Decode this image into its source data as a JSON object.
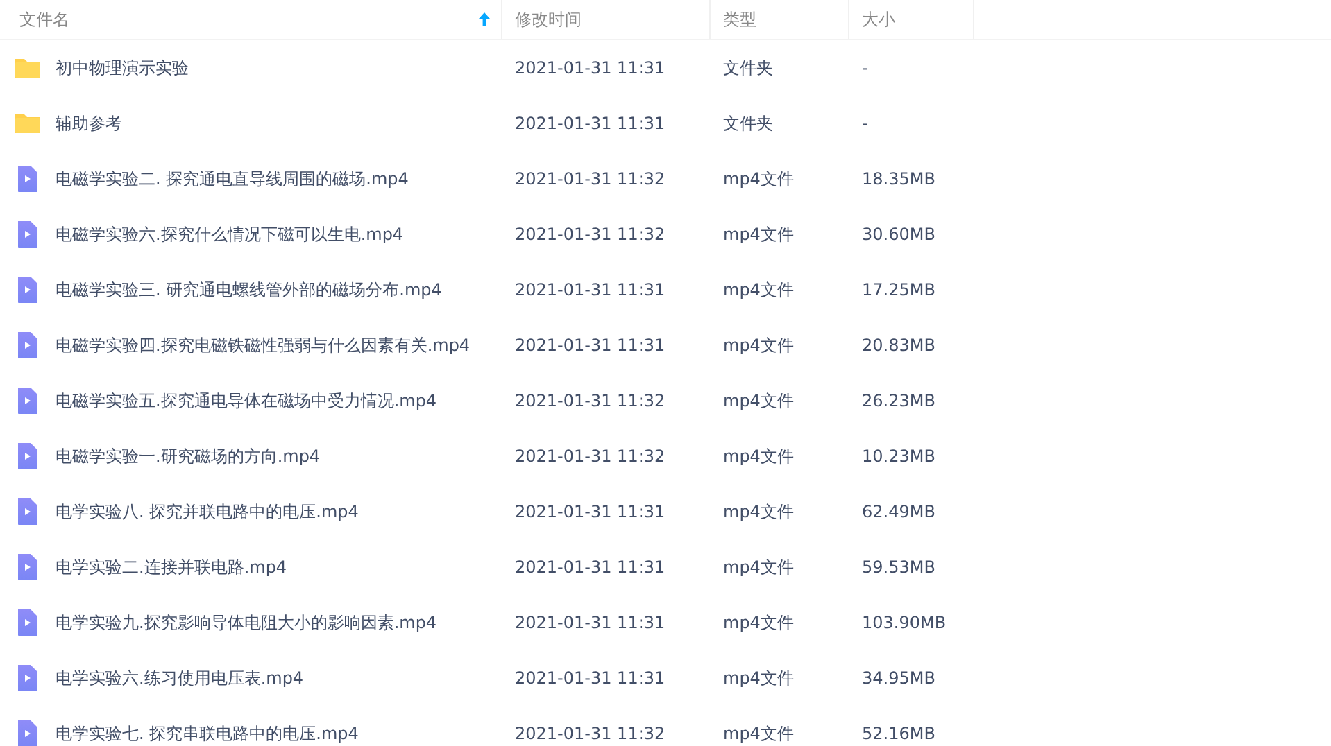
{
  "table": {
    "columns": [
      {
        "label": "文件名",
        "sorted": true
      },
      {
        "label": "修改时间",
        "sorted": false
      },
      {
        "label": "类型",
        "sorted": false
      },
      {
        "label": "大小",
        "sorted": false
      }
    ],
    "rows": [
      {
        "kind": "folder",
        "name": "初中物理演示实验",
        "modified": "2021-01-31 11:31",
        "type": "文件夹",
        "size": "-"
      },
      {
        "kind": "folder",
        "name": "辅助参考",
        "modified": "2021-01-31 11:31",
        "type": "文件夹",
        "size": "-"
      },
      {
        "kind": "video",
        "name": "电磁学实验二. 探究通电直导线周围的磁场.mp4",
        "modified": "2021-01-31 11:32",
        "type": "mp4文件",
        "size": "18.35MB"
      },
      {
        "kind": "video",
        "name": "电磁学实验六.探究什么情况下磁可以生电.mp4",
        "modified": "2021-01-31 11:32",
        "type": "mp4文件",
        "size": "30.60MB"
      },
      {
        "kind": "video",
        "name": "电磁学实验三. 研究通电螺线管外部的磁场分布.mp4",
        "modified": "2021-01-31 11:31",
        "type": "mp4文件",
        "size": "17.25MB"
      },
      {
        "kind": "video",
        "name": "电磁学实验四.探究电磁铁磁性强弱与什么因素有关.mp4",
        "modified": "2021-01-31 11:31",
        "type": "mp4文件",
        "size": "20.83MB"
      },
      {
        "kind": "video",
        "name": "电磁学实验五.探究通电导体在磁场中受力情况.mp4",
        "modified": "2021-01-31 11:32",
        "type": "mp4文件",
        "size": "26.23MB"
      },
      {
        "kind": "video",
        "name": "电磁学实验一.研究磁场的方向.mp4",
        "modified": "2021-01-31 11:32",
        "type": "mp4文件",
        "size": "10.23MB"
      },
      {
        "kind": "video",
        "name": "电学实验八. 探究并联电路中的电压.mp4",
        "modified": "2021-01-31 11:31",
        "type": "mp4文件",
        "size": "62.49MB"
      },
      {
        "kind": "video",
        "name": "电学实验二.连接并联电路.mp4",
        "modified": "2021-01-31 11:31",
        "type": "mp4文件",
        "size": "59.53MB"
      },
      {
        "kind": "video",
        "name": "电学实验九.探究影响导体电阻大小的影响因素.mp4",
        "modified": "2021-01-31 11:31",
        "type": "mp4文件",
        "size": "103.90MB"
      },
      {
        "kind": "video",
        "name": "电学实验六.练习使用电压表.mp4",
        "modified": "2021-01-31 11:31",
        "type": "mp4文件",
        "size": "34.95MB"
      },
      {
        "kind": "video",
        "name": "电学实验七. 探究串联电路中的电压.mp4",
        "modified": "2021-01-31 11:32",
        "type": "mp4文件",
        "size": "52.16MB"
      }
    ]
  }
}
